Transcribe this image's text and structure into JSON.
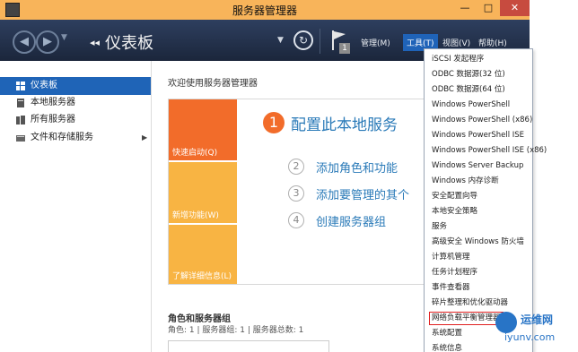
{
  "window": {
    "title": "服务器管理器",
    "min_label": "—",
    "max_label": "□",
    "close_label": "✕"
  },
  "header": {
    "breadcrumb_arrows": "◂◂",
    "breadcrumb": "仪表板",
    "notification_count": "1",
    "menus": {
      "manage": "管理(M)",
      "tools": "工具(T)",
      "view": "视图(V)",
      "help": "帮助(H)"
    }
  },
  "sidebar": {
    "items": [
      {
        "label": "仪表板",
        "icon": "dashboard-icon",
        "selected": true
      },
      {
        "label": "本地服务器",
        "icon": "server-icon"
      },
      {
        "label": "所有服务器",
        "icon": "servers-icon"
      },
      {
        "label": "文件和存储服务",
        "icon": "storage-icon",
        "has_children": true
      }
    ]
  },
  "main": {
    "welcome_title": "欢迎使用服务器管理器",
    "tiles": {
      "quick_start": "快速启动(Q)",
      "whats_new": "新增功能(W)",
      "learn_more": "了解详细信息(L)"
    },
    "steps": [
      {
        "num": "1",
        "text": "配置此本地服务"
      },
      {
        "num": "2",
        "text": "添加角色和功能"
      },
      {
        "num": "3",
        "text": "添加要管理的其个"
      },
      {
        "num": "4",
        "text": "创建服务器组"
      }
    ],
    "roles_title": "角色和服务器组",
    "roles_subtitle": "角色: 1 | 服务器组: 1 | 服务器总数: 1"
  },
  "tools_menu": {
    "items": [
      "iSCSI 发起程序",
      "ODBC 数据源(32 位)",
      "ODBC 数据源(64 位)",
      "Windows PowerShell",
      "Windows PowerShell (x86)",
      "Windows PowerShell ISE",
      "Windows PowerShell ISE (x86)",
      "Windows Server Backup",
      "Windows 内存诊断",
      "安全配置向导",
      "本地安全策略",
      "服务",
      "高级安全 Windows 防火墙",
      "计算机管理",
      "任务计划程序",
      "事件查看器",
      "碎片整理和优化驱动器",
      "网络负载平衡管理器",
      "系统配置",
      "系统信息"
    ],
    "highlighted": "网络负载平衡管理器"
  },
  "watermark": {
    "name": "运维网",
    "url": "iyunv.com"
  },
  "colors": {
    "title_bar": "#f8b45a",
    "header": "#1e2c44",
    "selection": "#1f64b7",
    "tile_orange": "#f26c2a",
    "tile_yellow": "#f8b443",
    "link_blue": "#2a7ab8",
    "highlight_border": "#e02020"
  }
}
